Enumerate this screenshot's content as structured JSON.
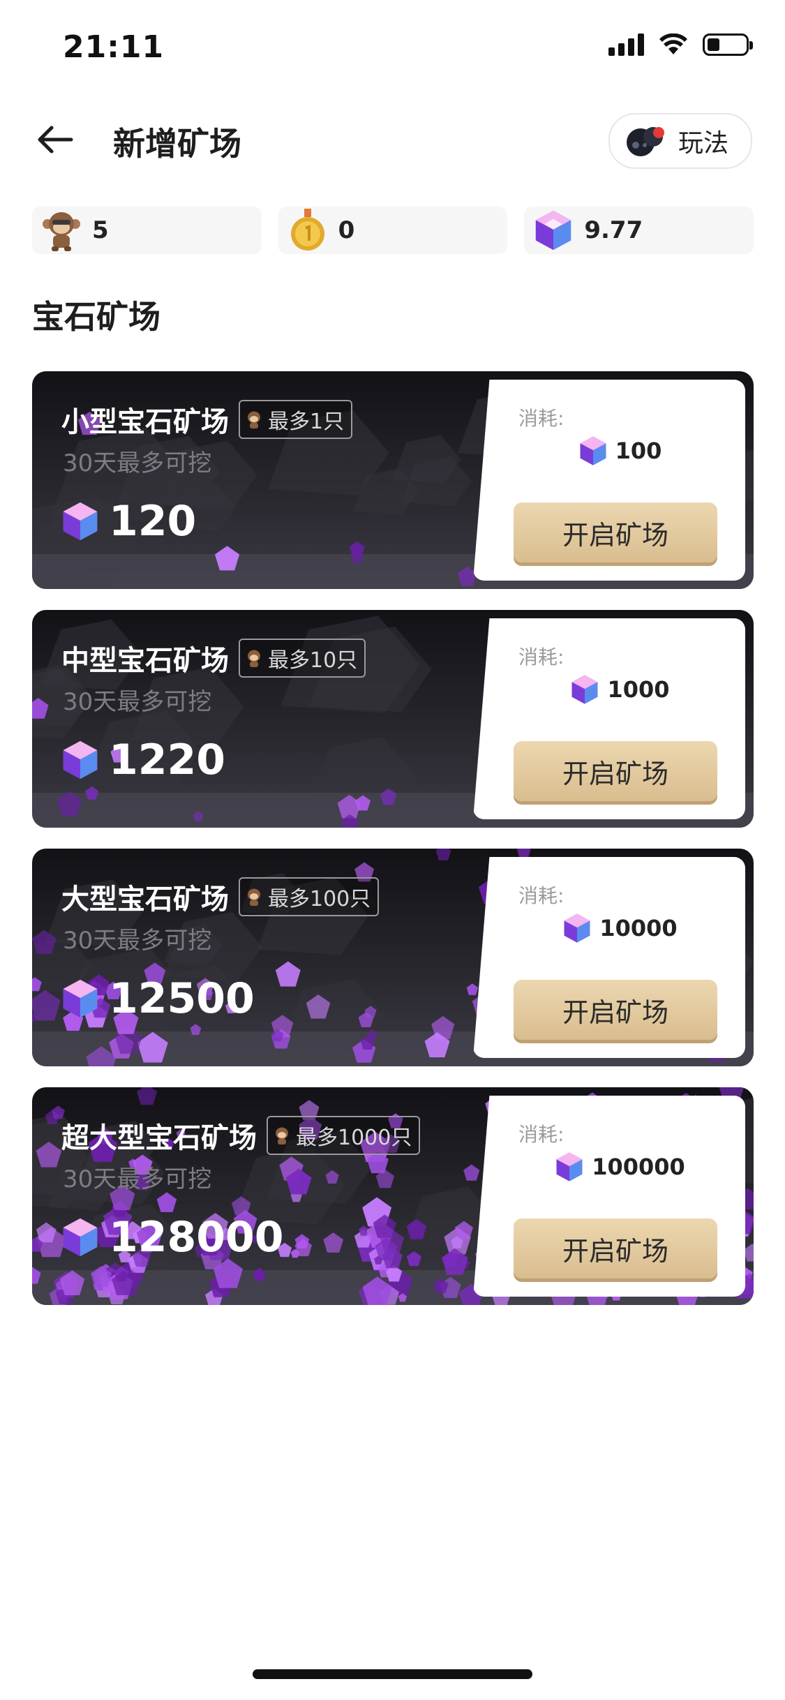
{
  "status_bar": {
    "time": "21:11"
  },
  "header": {
    "title": "新增矿场",
    "rules_label": "玩法"
  },
  "stats": [
    {
      "icon": "monkey-icon",
      "value": "5"
    },
    {
      "icon": "gold-medal-icon",
      "value": "0"
    },
    {
      "icon": "gem-icon",
      "value": "9.77"
    }
  ],
  "section_title": "宝石矿场",
  "mines": [
    {
      "name": "小型宝石矿场",
      "capacity": "最多1只",
      "subtitle": "30天最多可挖",
      "yield": "120",
      "cost_label": "消耗:",
      "cost": "100",
      "button": "开启矿场",
      "gem_density": 1
    },
    {
      "name": "中型宝石矿场",
      "capacity": "最多10只",
      "subtitle": "30天最多可挖",
      "yield": "1220",
      "cost_label": "消耗:",
      "cost": "1000",
      "button": "开启矿场",
      "gem_density": 2
    },
    {
      "name": "大型宝石矿场",
      "capacity": "最多100只",
      "subtitle": "30天最多可挖",
      "yield": "12500",
      "cost_label": "消耗:",
      "cost": "10000",
      "button": "开启矿场",
      "gem_density": 3
    },
    {
      "name": "超大型宝石矿场",
      "capacity": "最多1000只",
      "subtitle": "30天最多可挖",
      "yield": "128000",
      "cost_label": "消耗:",
      "cost": "100000",
      "button": "开启矿场",
      "gem_density": 4
    }
  ],
  "colors": {
    "gold_button": "#e3caa0",
    "card_bg": "#1c1b20",
    "gem_purple": "#8a2fd0"
  }
}
